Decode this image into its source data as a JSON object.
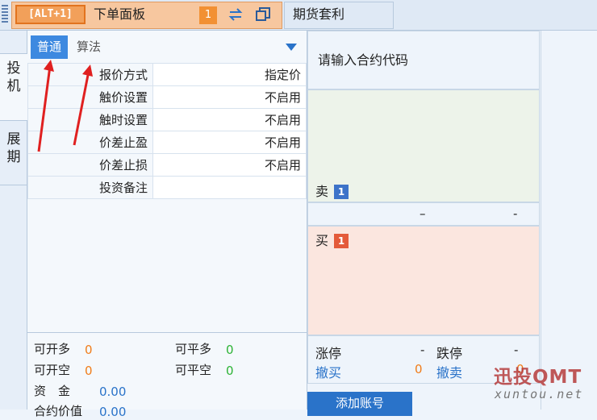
{
  "tabs": {
    "order": {
      "hotkey": "[ALT+1]",
      "title": "下单面板",
      "count": "1"
    },
    "arbitrage": {
      "title": "期货套利"
    }
  },
  "side_tabs": [
    {
      "label": "投\n机"
    },
    {
      "label": "展\n期"
    }
  ],
  "mode_tabs": {
    "normal": "普通",
    "algo": "算法"
  },
  "params": [
    {
      "label": "报价方式",
      "value": "指定价"
    },
    {
      "label": "触价设置",
      "value": "不启用"
    },
    {
      "label": "触时设置",
      "value": "不启用"
    },
    {
      "label": "价差止盈",
      "value": "不启用"
    },
    {
      "label": "价差止损",
      "value": "不启用"
    },
    {
      "label": "投资备注",
      "value": ""
    }
  ],
  "stats": {
    "open_long": {
      "label": "可开多",
      "value": "0"
    },
    "close_long": {
      "label": "可平多",
      "value": "0"
    },
    "open_short": {
      "label": "可开空",
      "value": "0"
    },
    "close_short": {
      "label": "可平空",
      "value": "0"
    },
    "funds": {
      "label": "资　金",
      "value": "0.00"
    },
    "contract_value": {
      "label": "合约价值",
      "value": "0.00"
    }
  },
  "quote": {
    "code_prompt": "请输入合约代码",
    "sell": {
      "label": "卖",
      "level": "1"
    },
    "mid_left": "–",
    "mid_right": "-",
    "buy": {
      "label": "买",
      "level": "1"
    },
    "limit_up": {
      "label": "涨停",
      "value": "-"
    },
    "limit_down": {
      "label": "跌停",
      "value": "-"
    },
    "cancel_buy": {
      "label": "撤买",
      "value": "0"
    },
    "cancel_sell": {
      "label": "撤卖",
      "value": "0"
    }
  },
  "add_account": "添加账号",
  "watermark": {
    "logo": "迅投QMT",
    "url": "xuntou.net"
  },
  "colors": {
    "accent": "#2a73c9",
    "orange": "#f07d1a",
    "green": "#2db336",
    "sell_bg": "#edf3ea",
    "buy_bg": "#fbe6df"
  }
}
